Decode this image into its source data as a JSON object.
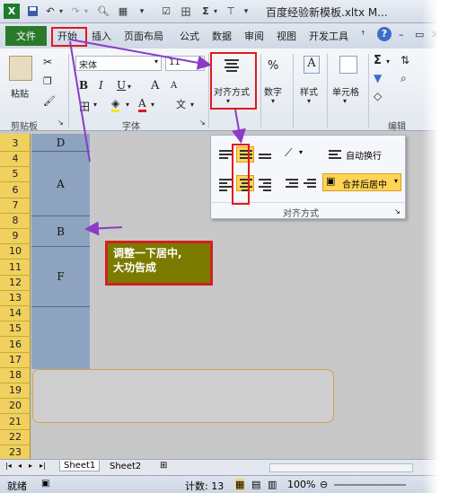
{
  "titlebar": {
    "title": "百度经验新模板.xltx M..."
  },
  "tabs": {
    "file": "文件",
    "items": [
      "开始",
      "插入",
      "页面布局",
      "公式",
      "数据",
      "审阅",
      "视图",
      "开发工具"
    ]
  },
  "ribbon": {
    "paste": "粘贴",
    "clipboard_group": "剪贴板",
    "font_name": "宋体",
    "font_size": "11",
    "bold": "B",
    "italic": "I",
    "underline": "U",
    "font_grow": "A",
    "font_shrink": "A",
    "font_group": "字体",
    "alignment_button": "对齐方式",
    "number_button": "数字",
    "number_symbol": "%",
    "styles_button": "样式",
    "cells_button": "单元格",
    "editing_group": "编辑"
  },
  "popup": {
    "wrap_text": "自动换行",
    "merge_center": "合并后居中",
    "group_label": "对齐方式"
  },
  "grid": {
    "rows": [
      "3",
      "4",
      "5",
      "6",
      "7",
      "8",
      "9",
      "10",
      "11",
      "12",
      "13",
      "14",
      "15",
      "16",
      "17",
      "18",
      "19",
      "20",
      "21",
      "22",
      "23"
    ],
    "cells": [
      {
        "label": "D"
      },
      {
        "label": "A"
      },
      {
        "label": "B"
      },
      {
        "label": "F"
      },
      {
        "label": ""
      }
    ]
  },
  "annotation": {
    "line1": "调整一下居中,",
    "line2": "大功告成"
  },
  "sheets": {
    "sheet1": "Sheet1",
    "sheet2": "Sheet2"
  },
  "status": {
    "ready": "就绪",
    "count": "计数: 13",
    "zoom": "100%"
  },
  "colors": {
    "file_tab": "#2a7a2a",
    "highlight_red": "#e01a1a",
    "arrow_purple": "#8a3cc8",
    "row_header": "#f0d05e",
    "merged_cells": "#8ea3bf"
  }
}
